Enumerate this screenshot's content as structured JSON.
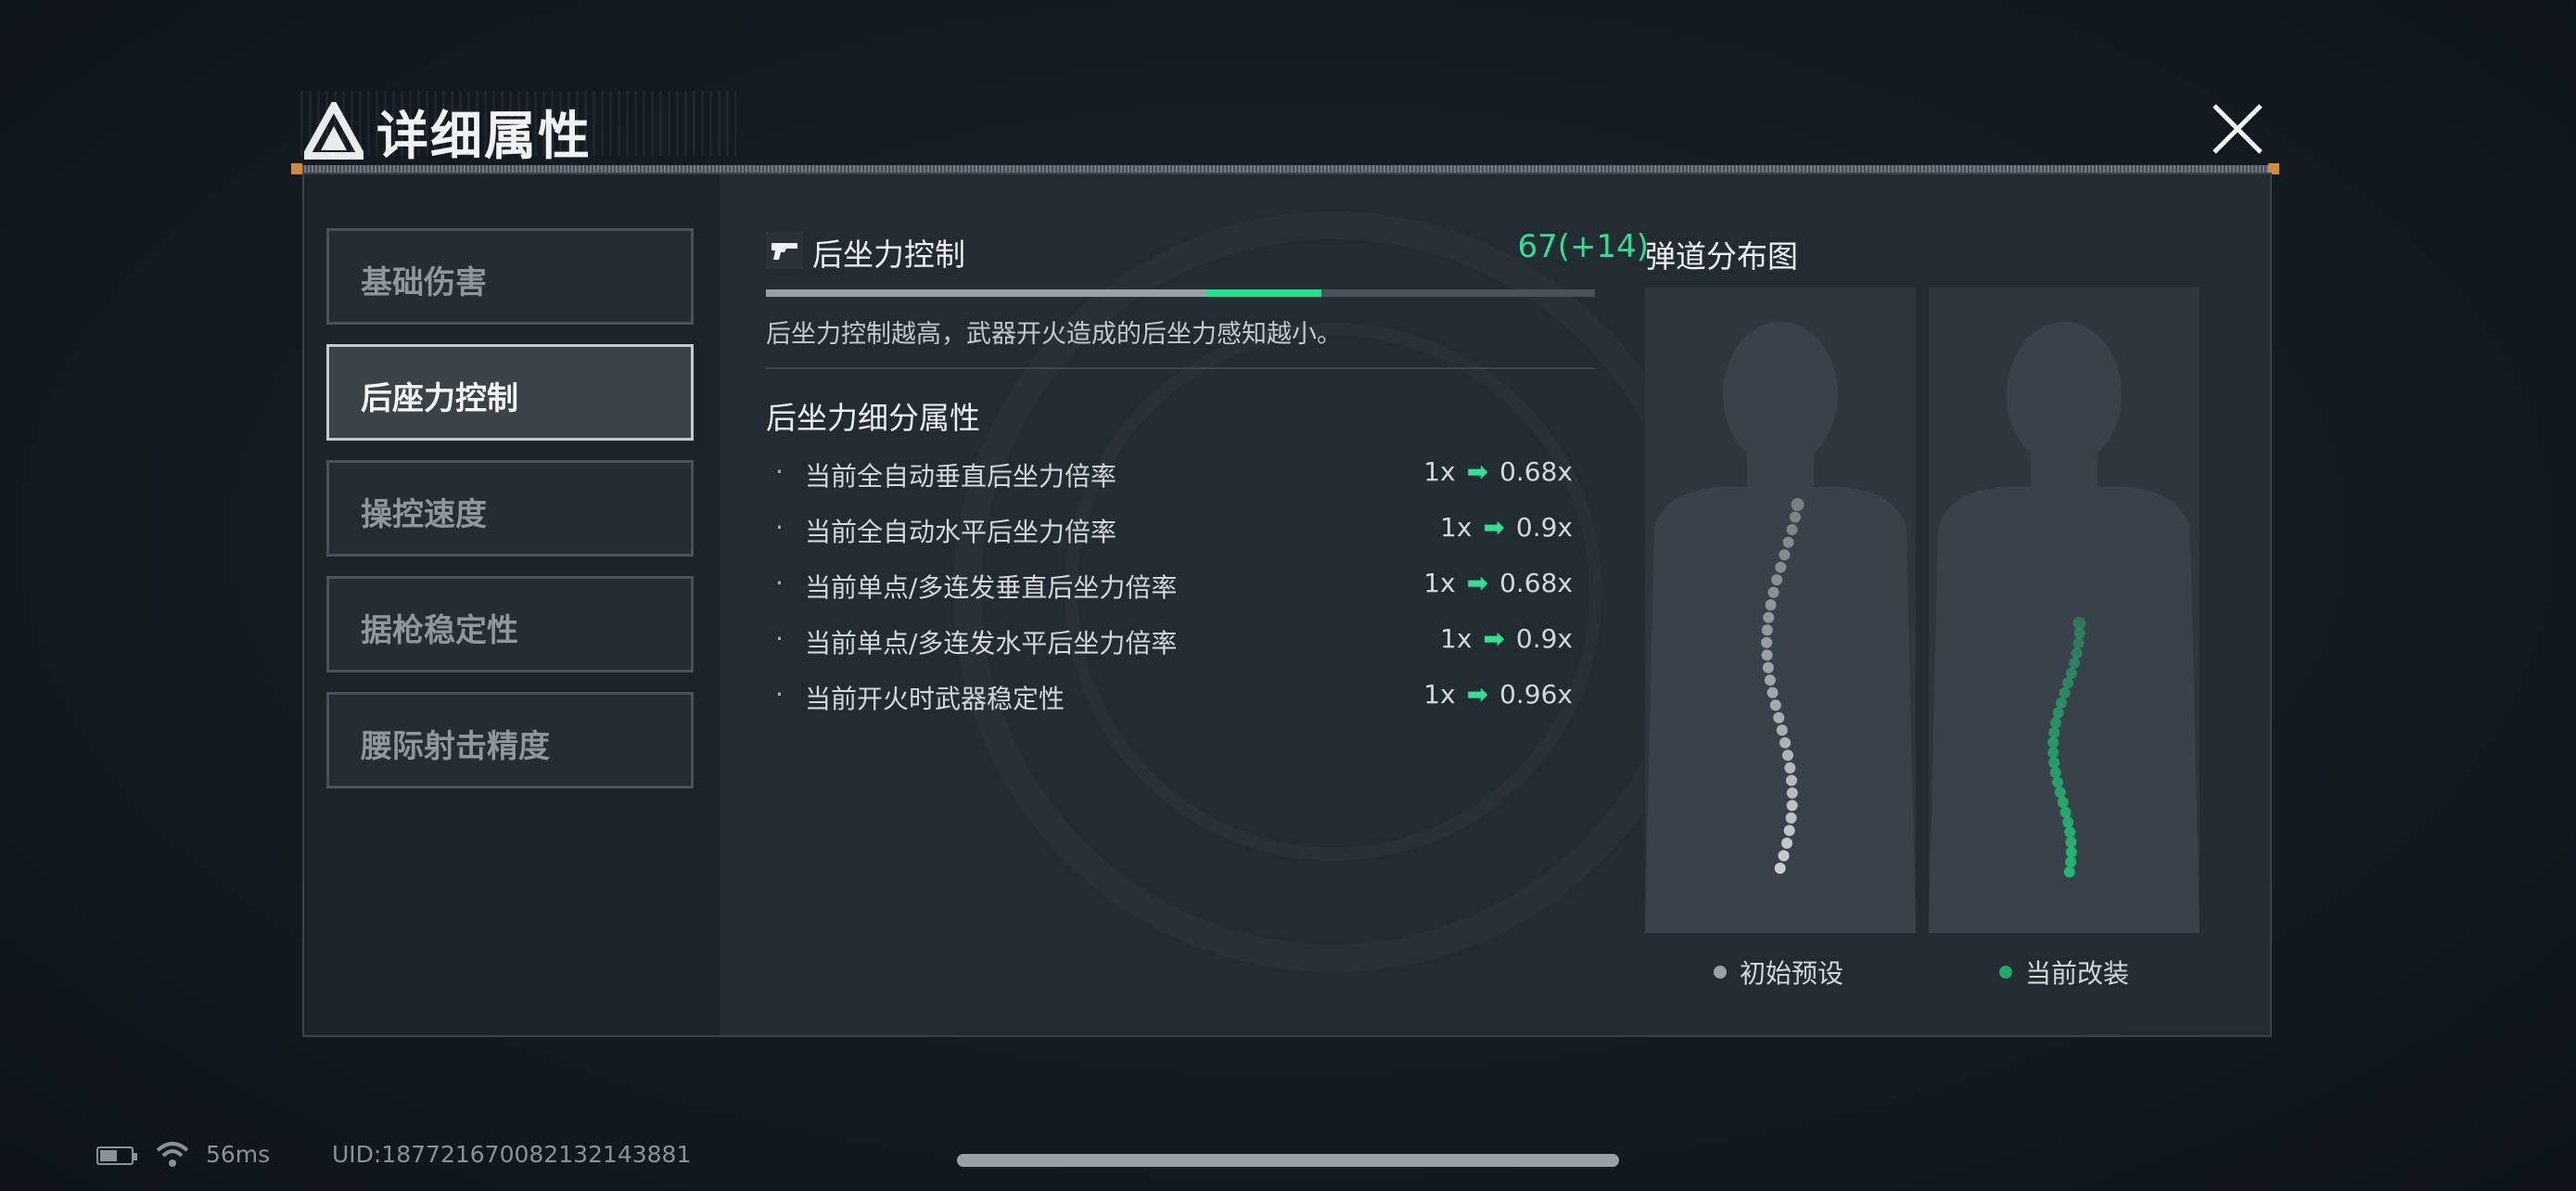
{
  "header": {
    "title": "详细属性"
  },
  "tabs": [
    {
      "label": "基础伤害",
      "active": false
    },
    {
      "label": "后座力控制",
      "active": true
    },
    {
      "label": "操控速度",
      "active": false
    },
    {
      "label": "据枪稳定性",
      "active": false
    },
    {
      "label": "腰际射击精度",
      "active": false
    }
  ],
  "stat": {
    "name": "后坐力控制",
    "value": "67(+14)",
    "progress_base_fraction": 0.53,
    "progress_new_fraction": 0.67,
    "description": "后坐力控制越高，武器开火造成的后坐力感知越小。"
  },
  "details": {
    "title": "后坐力细分属性",
    "rows": [
      {
        "label": "当前全自动垂直后坐力倍率",
        "from": "1x",
        "to": "0.68x"
      },
      {
        "label": "当前全自动水平后坐力倍率",
        "from": "1x",
        "to": "0.9x"
      },
      {
        "label": "当前单点/多连发垂直后坐力倍率",
        "from": "1x",
        "to": "0.68x"
      },
      {
        "label": "当前单点/多连发水平后坐力倍率",
        "from": "1x",
        "to": "0.9x"
      },
      {
        "label": "当前开火时武器稳定性",
        "from": "1x",
        "to": "0.96x"
      }
    ],
    "bullet": "·"
  },
  "trajectory": {
    "title": "弹道分布图",
    "legend": [
      {
        "label": "初始预设",
        "color": "#9aa1a7"
      },
      {
        "label": "当前改装",
        "color": "#1fa86a"
      }
    ]
  },
  "footer": {
    "ping": "56ms",
    "uid": "UID:187721670082132143881"
  },
  "colors": {
    "accent": "#2ee08f",
    "panel": "#242c33"
  },
  "icons": [
    "logo-icon",
    "close-icon",
    "gun-icon",
    "arrow-right-icon",
    "battery-icon",
    "wifi-icon"
  ]
}
